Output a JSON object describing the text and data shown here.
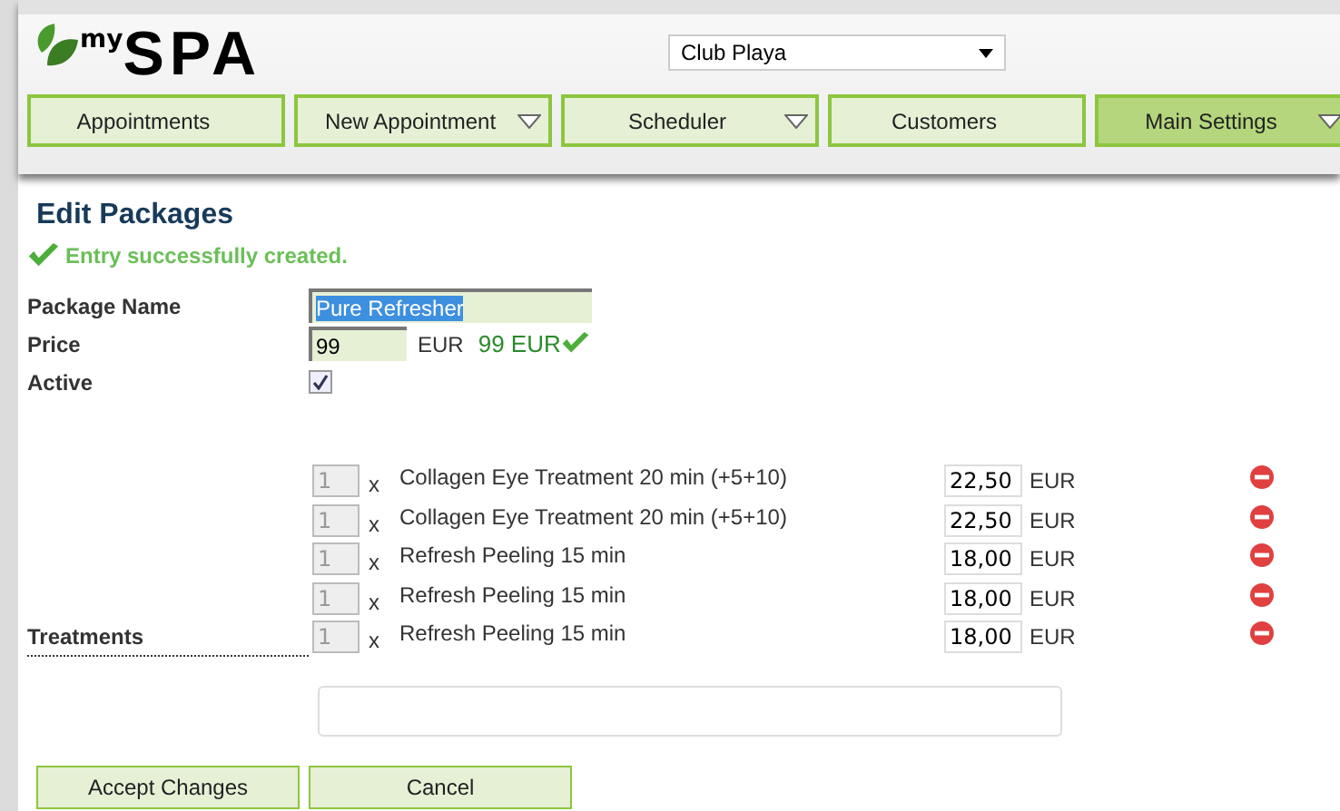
{
  "logo": {
    "prefix": "my",
    "name": "SPA"
  },
  "location_select": {
    "value": "Club Playa"
  },
  "nav": [
    {
      "label": "Appointments",
      "dropdown": false,
      "selected": false
    },
    {
      "label": "New Appointment",
      "dropdown": true,
      "selected": false
    },
    {
      "label": "Scheduler",
      "dropdown": true,
      "selected": false
    },
    {
      "label": "Customers",
      "dropdown": false,
      "selected": false
    },
    {
      "label": "Main Settings",
      "dropdown": true,
      "selected": true
    }
  ],
  "title": "Edit Packages",
  "message": "Entry successfully created.",
  "fields": {
    "package_name": {
      "label": "Package Name",
      "value": "Pure Refresher"
    },
    "price": {
      "label": "Price",
      "value": "99",
      "unit": "EUR",
      "confirmation": "99 EUR"
    },
    "active": {
      "label": "Active",
      "checked": true
    }
  },
  "treatments": {
    "label": "Treatments",
    "rows": [
      {
        "quantity": "1",
        "multiplier": "x",
        "name": "Collagen Eye Treatment 20 min (+5+10)",
        "price": "22,50",
        "unit": "EUR"
      },
      {
        "quantity": "1",
        "multiplier": "x",
        "name": "Collagen Eye Treatment 20 min (+5+10)",
        "price": "22,50",
        "unit": "EUR"
      },
      {
        "quantity": "1",
        "multiplier": "x",
        "name": "Refresh Peeling 15 min",
        "price": "18,00",
        "unit": "EUR"
      },
      {
        "quantity": "1",
        "multiplier": "x",
        "name": "Refresh Peeling 15 min",
        "price": "18,00",
        "unit": "EUR"
      },
      {
        "quantity": "1",
        "multiplier": "x",
        "name": "Refresh Peeling 15 min",
        "price": "18,00",
        "unit": "EUR"
      }
    ]
  },
  "buttons": [
    "Accept Changes",
    "Cancel"
  ]
}
